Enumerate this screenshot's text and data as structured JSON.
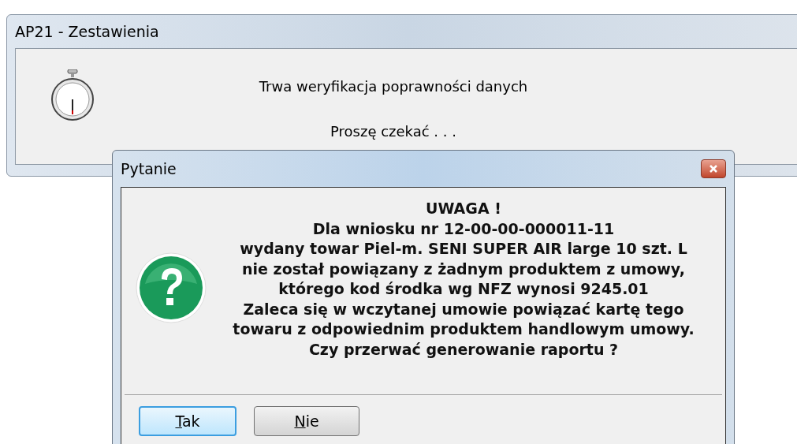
{
  "background_window": {
    "title": "AP21 - Zestawienia",
    "lines": [
      "Trwa weryfikacja poprawności danych",
      "Proszę czekać . . ."
    ]
  },
  "dialog": {
    "title": "Pytanie",
    "message_lines": [
      "UWAGA !",
      "Dla wniosku nr 12-00-00-000011-11",
      "wydany towar Piel-m. SENI SUPER AIR large 10 szt. L",
      "nie został powiązany z żadnym produktem z umowy,",
      "którego kod środka wg NFZ wynosi 9245.01",
      "Zaleca się w wczytanej umowie powiązać kartę tego",
      "towaru z odpowiednim produktem handlowym umowy.",
      "Czy przerwać generowanie raportu ?"
    ],
    "buttons": [
      {
        "label": "Tak",
        "focused": true
      },
      {
        "label": "Nie",
        "focused": false
      }
    ]
  }
}
